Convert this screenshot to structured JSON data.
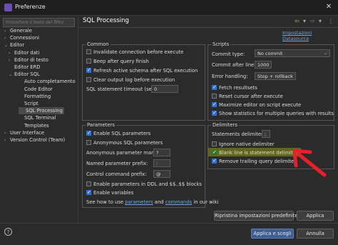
{
  "window": {
    "title": "Preferenze"
  },
  "filter": {
    "placeholder": "Immettere il testo del filtro"
  },
  "tree": {
    "items": [
      {
        "label": "Generale",
        "arrow": "›"
      },
      {
        "label": "Connessioni",
        "arrow": "›"
      },
      {
        "label": "Editor",
        "arrow": "⌄"
      },
      {
        "label": "Editor dati",
        "arrow": "›"
      },
      {
        "label": "Editor di testo",
        "arrow": "›"
      },
      {
        "label": "Editor ERD",
        "arrow": ""
      },
      {
        "label": "Editor SQL",
        "arrow": "⌄"
      },
      {
        "label": "Auto completamento",
        "arrow": ""
      },
      {
        "label": "Code Editor",
        "arrow": ""
      },
      {
        "label": "Formatting",
        "arrow": ""
      },
      {
        "label": "Script",
        "arrow": ""
      },
      {
        "label": "SQL Processing",
        "arrow": ""
      },
      {
        "label": "SQL Terminal",
        "arrow": ""
      },
      {
        "label": "Templates",
        "arrow": ""
      },
      {
        "label": "User Interface",
        "arrow": "›"
      },
      {
        "label": "Version Control (Team)",
        "arrow": "›"
      }
    ]
  },
  "header": {
    "title": "SQL Processing",
    "datasource_link": "Impostazioni Datasource"
  },
  "common": {
    "label": "Common",
    "invalidate": "Invalidate connection before execute",
    "beep": "Beep after query finish",
    "refresh": "Refresh active schema after SQL execution",
    "clear_log": "Clear output log before execution",
    "timeout_label": "SQL statement timeout (sec):",
    "timeout_value": "0"
  },
  "scripts": {
    "label": "Scripts",
    "commit_type_label": "Commit type:",
    "commit_type_value": "No commit",
    "commit_after_label": "Commit after line:",
    "commit_after_value": "1000",
    "error_label": "Error handling:",
    "error_value": "Stop + rollback",
    "fetch": "Fetch resultsets",
    "reset_cursor": "Reset cursor after execute",
    "maximize": "Maximize editor on script execute",
    "show_stats": "Show statistics for multiple queries with results"
  },
  "parameters": {
    "label": "Parameters",
    "enable_sql": "Enable SQL parameters",
    "anonymous": "Anonymous SQL parameters",
    "anon_mark_label": "Anonymous parameter mark:",
    "anon_mark_value": "?",
    "named_prefix_label": "Named parameter prefix:",
    "named_prefix_value": ":",
    "control_prefix_label": "Control command prefix:",
    "control_prefix_value": "@",
    "ddl_blocks": "Enable parameters in DDL and $$..$$ blocks",
    "enable_vars": "Enable variables",
    "howto_prefix": "See how to use ",
    "howto_params": "parameters",
    "howto_and": " and ",
    "howto_commands": "commands",
    "howto_suffix": " in our wiki"
  },
  "delimiters": {
    "label": "Delimiters",
    "statements_label": "Statements delimiter:",
    "statements_value": ";",
    "ignore_native": "Ignore native delimiter",
    "blank_line": "Blank line is statement delimiter",
    "remove_trailing": "Remove trailing query delimiter"
  },
  "buttons": {
    "restore": "Ripristina impostazioni predefinite",
    "apply": "Applica",
    "apply_close": "Applica e scegli",
    "cancel": "Annulla"
  },
  "colors": {
    "annotation_arrow": "#e8202a",
    "highlight": "#c8d400",
    "accent": "#2f6fd8"
  }
}
